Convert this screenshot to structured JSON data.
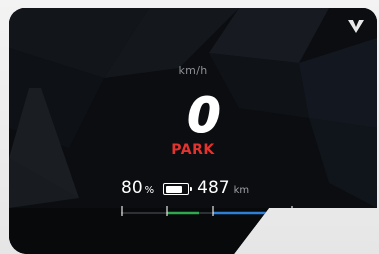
{
  "display": {
    "speed_unit": "km/h",
    "speed_value": "0",
    "gear": "PARK",
    "state_of_charge": "80",
    "state_of_charge_unit": "%",
    "battery_level": 0.8,
    "range": "487",
    "range_unit": "km"
  },
  "icons": {
    "brand_logo": "brand-logo-icon",
    "battery": "battery-icon"
  },
  "colors": {
    "gear_text": "#e2332e",
    "screen_background": "#0b0d10",
    "scale_green": "#2fa84f",
    "scale_blue": "#2e7fd6"
  }
}
